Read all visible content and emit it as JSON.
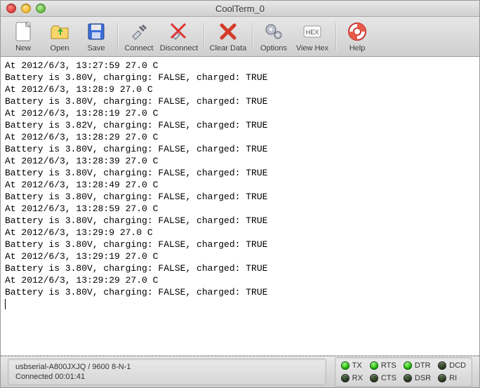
{
  "window": {
    "title": "CoolTerm_0"
  },
  "toolbar": {
    "new": "New",
    "open": "Open",
    "save": "Save",
    "connect": "Connect",
    "disconnect": "Disconnect",
    "clear": "Clear Data",
    "options": "Options",
    "viewhex": "View Hex",
    "help": "Help"
  },
  "terminal": {
    "lines": [
      "At 2012/6/3, 13:27:59 27.0 C",
      "Battery is 3.80V, charging: FALSE, charged: TRUE",
      "At 2012/6/3, 13:28:9 27.0 C",
      "Battery is 3.80V, charging: FALSE, charged: TRUE",
      "At 2012/6/3, 13:28:19 27.0 C",
      "Battery is 3.82V, charging: FALSE, charged: TRUE",
      "At 2012/6/3, 13:28:29 27.0 C",
      "Battery is 3.80V, charging: FALSE, charged: TRUE",
      "At 2012/6/3, 13:28:39 27.0 C",
      "Battery is 3.80V, charging: FALSE, charged: TRUE",
      "At 2012/6/3, 13:28:49 27.0 C",
      "Battery is 3.80V, charging: FALSE, charged: TRUE",
      "At 2012/6/3, 13:28:59 27.0 C",
      "Battery is 3.80V, charging: FALSE, charged: TRUE",
      "At 2012/6/3, 13:29:9 27.0 C",
      "Battery is 3.80V, charging: FALSE, charged: TRUE",
      "At 2012/6/3, 13:29:19 27.0 C",
      "Battery is 3.80V, charging: FALSE, charged: TRUE",
      "At 2012/6/3, 13:29:29 27.0 C",
      "Battery is 3.80V, charging: FALSE, charged: TRUE"
    ]
  },
  "status": {
    "port": "usbserial-A800JXJQ / 9600 8-N-1",
    "conn": "Connected 00:01:41",
    "leds": {
      "tx": {
        "label": "TX",
        "on": true
      },
      "rts": {
        "label": "RTS",
        "on": true
      },
      "dtr": {
        "label": "DTR",
        "on": true
      },
      "dcd": {
        "label": "DCD",
        "on": false
      },
      "rx": {
        "label": "RX",
        "on": false
      },
      "cts": {
        "label": "CTS",
        "on": false
      },
      "dsr": {
        "label": "DSR",
        "on": false
      },
      "ri": {
        "label": "RI",
        "on": false
      }
    }
  }
}
